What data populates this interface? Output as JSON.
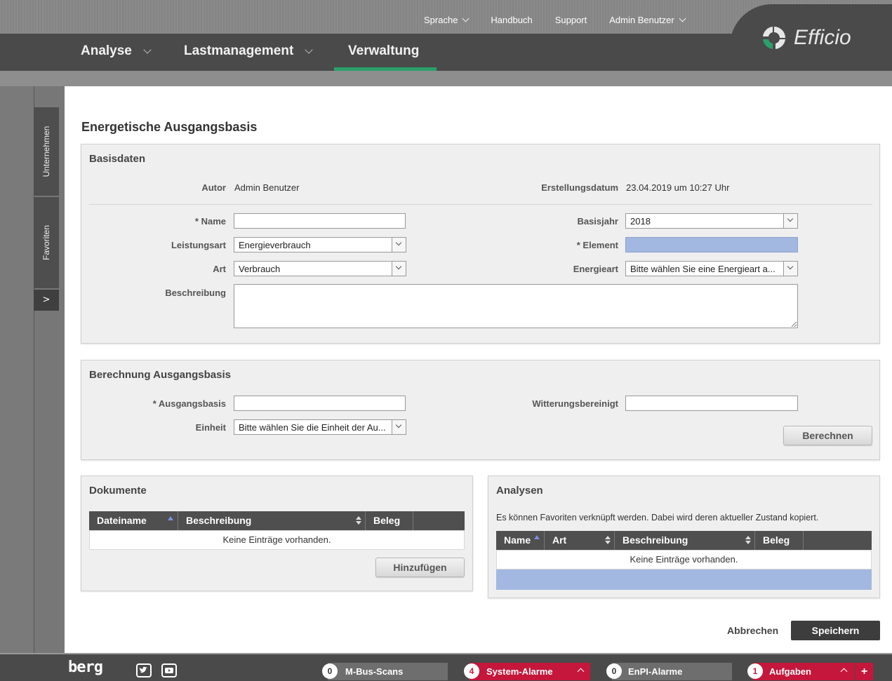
{
  "topnav": {
    "language": "Sprache",
    "manual": "Handbuch",
    "support": "Support",
    "user": "Admin Benutzer"
  },
  "mainnav": {
    "analyse": "Analyse",
    "lastmanagement": "Lastmanagement",
    "verwaltung": "Verwaltung"
  },
  "brand": {
    "logo_text": "Efficio",
    "accent": "#2aa06a"
  },
  "sidetabs": {
    "unternehmen": "Unternehmen",
    "favoriten": "Favoriten",
    "expand": ">"
  },
  "page": {
    "title": "Energetische Ausgangsbasis"
  },
  "basisdaten": {
    "title": "Basisdaten",
    "author_label": "Autor",
    "author_value": "Admin Benutzer",
    "created_label": "Erstellungsdatum",
    "created_value": "23.04.2019 um 10:27 Uhr",
    "name_label": "* Name",
    "name_value": "",
    "basisjahr_label": "Basisjahr",
    "basisjahr_value": "2018",
    "leistungsart_label": "Leistungsart",
    "leistungsart_value": "Energieverbrauch",
    "element_label": "* Element",
    "element_value": "",
    "art_label": "Art",
    "art_value": "Verbrauch",
    "energieart_label": "Energieart",
    "energieart_value": "Bitte wählen Sie eine Energieart a...",
    "beschreibung_label": "Beschreibung",
    "beschreibung_value": ""
  },
  "berechnung": {
    "title": "Berechnung Ausgangsbasis",
    "ausgangsbasis_label": "* Ausgangsbasis",
    "ausgangsbasis_value": "",
    "witterung_label": "Witterungsbereinigt",
    "witterung_value": "",
    "einheit_label": "Einheit",
    "einheit_value": "Bitte wählen Sie die Einheit der Au...",
    "calc_button": "Berechnen"
  },
  "dokumente": {
    "title": "Dokumente",
    "columns": [
      "Dateiname",
      "Beschreibung",
      "Beleg"
    ],
    "empty": "Keine Einträge vorhanden.",
    "add_button": "Hinzufügen"
  },
  "analysen": {
    "title": "Analysen",
    "info": "Es können Favoriten verknüpft werden. Dabei wird deren aktueller Zustand kopiert.",
    "columns": [
      "Name",
      "Art",
      "Beschreibung",
      "Beleg"
    ],
    "empty": "Keine Einträge vorhanden."
  },
  "actions": {
    "cancel": "Abbrechen",
    "save": "Speichern"
  },
  "bottombar": {
    "brand": "berg",
    "mbus_count": "0",
    "mbus_label": "M-Bus-Scans",
    "sysalarm_count": "4",
    "sysalarm_label": "System-Alarme",
    "enpi_count": "0",
    "enpi_label": "EnPI-Alarme",
    "tasks_count": "1",
    "tasks_label": "Aufgaben",
    "plus": "+",
    "alert_color": "#c4173b"
  }
}
